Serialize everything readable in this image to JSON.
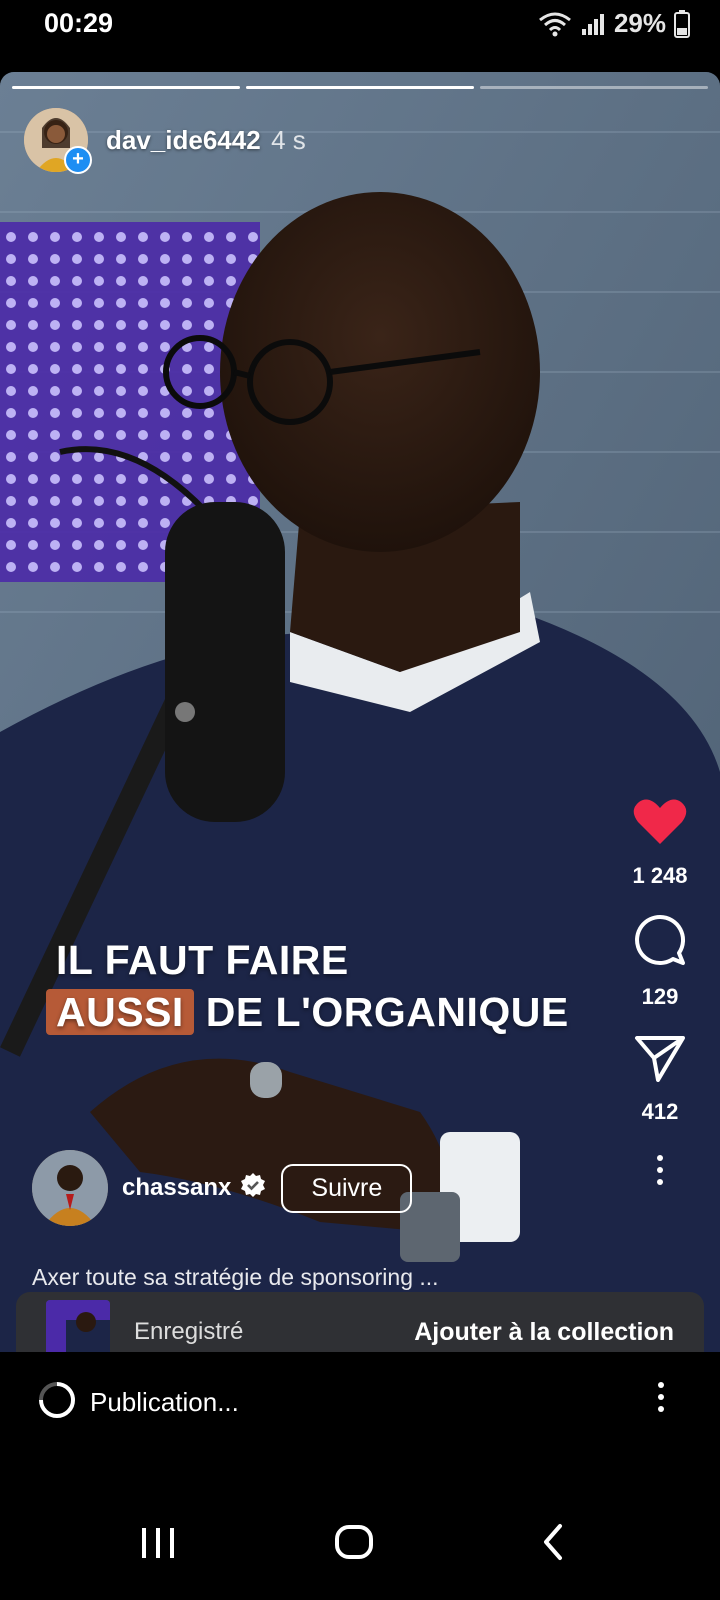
{
  "status_bar": {
    "time": "00:29",
    "battery": "29%"
  },
  "story": {
    "progress_segments": [
      1,
      1,
      0
    ],
    "poster": {
      "username": "dav_ide6442",
      "time_ago": "4 s"
    }
  },
  "reel": {
    "caption_line1": "IL FAUT FAIRE",
    "caption_highlight": "AUSSI",
    "caption_line2_rest": " DE L'ORGANIQUE",
    "likes": "1 248",
    "comments": "129",
    "shares": "412",
    "author": "chassanx",
    "follow_label": "Suivre",
    "description": "Axer toute sa stratégie de sponsoring ..."
  },
  "saved_toast": {
    "label": "Enregistré",
    "action": "Ajouter à la collection"
  },
  "publish_bar": {
    "text": "Publication..."
  },
  "colors": {
    "like": "#f02849",
    "follow_plus": "#1d8ef3",
    "caption_highlight": "#b65a37"
  },
  "icons": [
    "wifi-icon",
    "signal-icon",
    "battery-icon",
    "heart-icon",
    "comment-icon",
    "share-icon",
    "more-icon",
    "verified-icon",
    "spinner-icon",
    "recents-icon",
    "home-icon",
    "back-icon"
  ]
}
